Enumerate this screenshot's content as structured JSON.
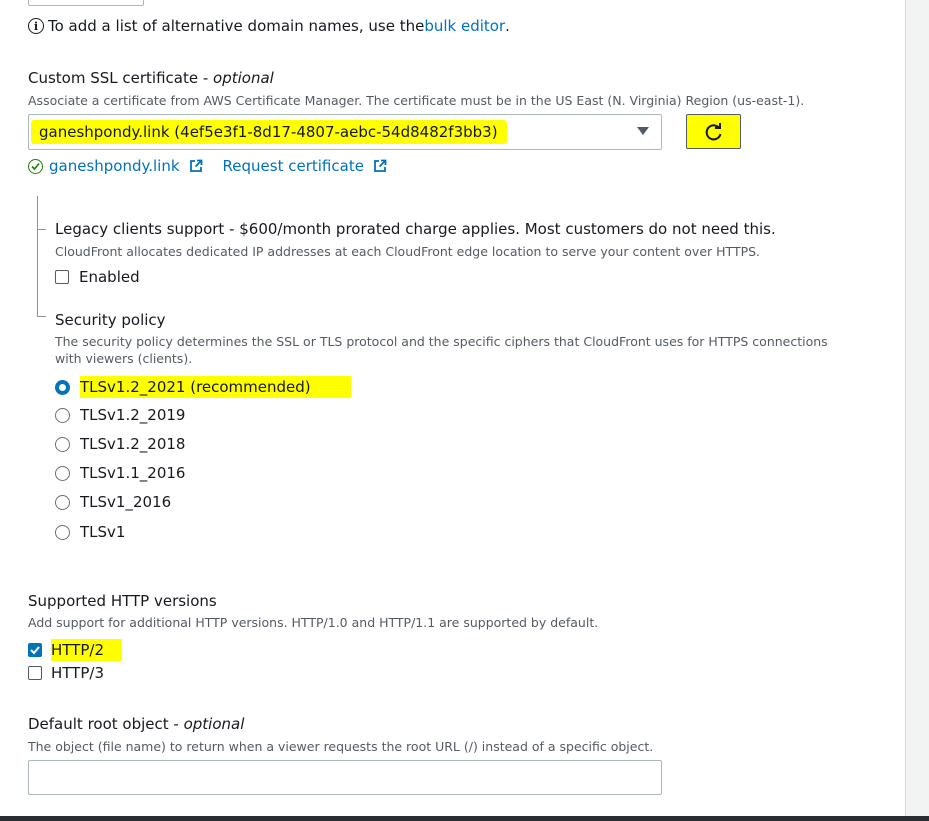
{
  "alt_domains": {
    "info_prefix": "To add a list of alternative domain names, use the ",
    "bulk_editor_link": "bulk editor",
    "info_suffix": "."
  },
  "ssl": {
    "label": "Custom SSL certificate - ",
    "label_optional": "optional",
    "description": "Associate a certificate from AWS Certificate Manager. The certificate must be in the US East (N. Virginia) Region (us-east-1).",
    "selected_value": "ganeshpondy.link (4ef5e3f1-8d17-4807-aebc-54d8482f3bb3)",
    "cert_link": "ganeshpondy.link",
    "request_link": "Request certificate"
  },
  "legacy": {
    "label": "Legacy clients support - $600/month prorated charge applies. Most customers do not need this.",
    "description": "CloudFront allocates dedicated IP addresses at each CloudFront edge location to serve your content over HTTPS.",
    "enabled_label": "Enabled"
  },
  "security_policy": {
    "label": "Security policy",
    "description": "The security policy determines the SSL or TLS protocol and the specific ciphers that CloudFront uses for HTTPS connections with viewers (clients).",
    "options": [
      "TLSv1.2_2021 (recommended)",
      "TLSv1.2_2019",
      "TLSv1.2_2018",
      "TLSv1.1_2016",
      "TLSv1_2016",
      "TLSv1"
    ],
    "selected_index": 0
  },
  "http_versions": {
    "label": "Supported HTTP versions",
    "description": "Add support for additional HTTP versions. HTTP/1.0 and HTTP/1.1 are supported by default.",
    "options": [
      "HTTP/2",
      "HTTP/3"
    ],
    "checked": [
      true,
      false
    ]
  },
  "root_object": {
    "label": "Default root object - ",
    "label_optional": "optional",
    "description": "The object (file name) to return when a viewer requests the root URL (/) instead of a specific object.",
    "value": ""
  },
  "colors": {
    "highlight": "#ffff00",
    "link": "#0073bb",
    "success": "#1d8102"
  },
  "icons": [
    "info-icon",
    "caret-down-icon",
    "refresh-icon",
    "check-circle-icon",
    "external-link-icon"
  ]
}
